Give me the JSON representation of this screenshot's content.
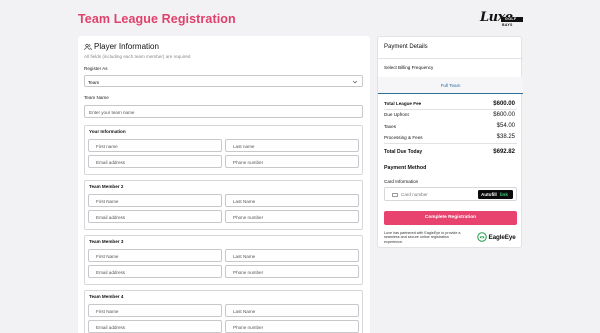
{
  "header": {
    "title": "Team League Registration",
    "brand_script": "Luxe",
    "brand_sub_top": "GOLF",
    "brand_sub_bottom": "BAYS"
  },
  "player": {
    "title": "Player Information",
    "subtitle": "All fields (including each team member) are required",
    "register_as_label": "Register As",
    "register_as_value": "Team",
    "team_name_label": "Team Name",
    "team_name_placeholder": "Enter your team name",
    "sections": [
      {
        "title": "Your Information",
        "first": "First name",
        "last": "Last name",
        "email": "Email address",
        "phone": "Phone number"
      },
      {
        "title": "Team Member 2",
        "first": "First Name",
        "last": "Last Name",
        "email": "Email address",
        "phone": "Phone number"
      },
      {
        "title": "Team Member 3",
        "first": "First Name",
        "last": "Last Name",
        "email": "Email address",
        "phone": "Phone number"
      },
      {
        "title": "Team Member 4",
        "first": "First Name",
        "last": "Last Name",
        "email": "Email address",
        "phone": "Phone number"
      }
    ]
  },
  "payment": {
    "title": "Payment Details",
    "billing_label": "Select Billing Frequency",
    "frequency_tab": "Full Team",
    "rows": [
      {
        "label": "Total League Fee",
        "value": "$600.00"
      },
      {
        "label": "Due Upfront",
        "value": "$600.00"
      },
      {
        "label": "Taxes",
        "value": "$54.00"
      },
      {
        "label": "Processing & Fees",
        "value": "$38.25"
      }
    ],
    "total_label": "Total Due Today",
    "total_value": "$692.82",
    "method_title": "Payment Method",
    "card_info_label": "Card Information",
    "card_number_placeholder": "Card number",
    "autofill_label": "Autofill",
    "autofill_link": "link",
    "complete_button": "Complete Registration",
    "partner_text": "Luxe has partnered with EagleEye to provide a seamless and secure online registration experience.",
    "partner_logo": "EagleEye"
  },
  "colors": {
    "accent": "#e8436f",
    "title": "#e0406c",
    "tab": "#2f6f9c",
    "link_green": "#41d07a",
    "eagle_green": "#1f9a4a"
  },
  "icons": {
    "player": "users-icon",
    "select": "chevron-down-icon",
    "card": "credit-card-icon",
    "partner": "eagle-eye-logo-icon"
  }
}
